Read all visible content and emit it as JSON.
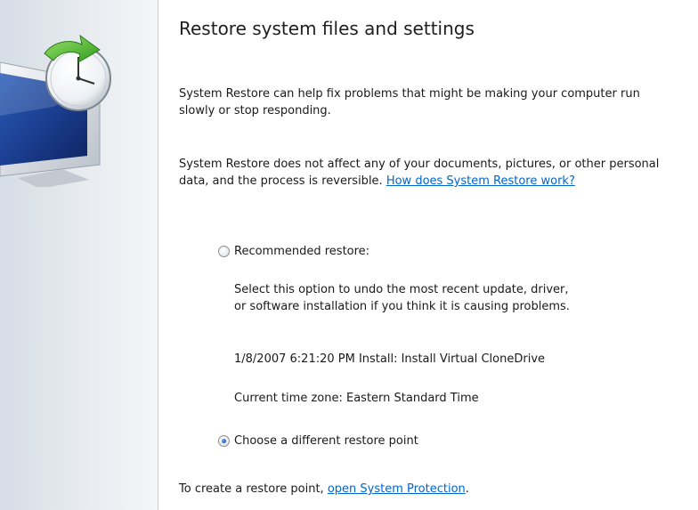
{
  "header": {
    "title": "Restore system files and settings",
    "icon": "system-restore-icon"
  },
  "intro": {
    "paragraph1": "System Restore can help fix problems that might be making your computer run slowly or stop responding.",
    "paragraph2_text": "System Restore does not affect any of your documents, pictures, or other personal data, and the process is reversible. ",
    "paragraph2_link": "How does System Restore work?"
  },
  "options": {
    "recommended": {
      "label": "Recommended restore:",
      "selected": false,
      "description_line1": "Select this option to undo the most recent update, driver,",
      "description_line2": "or software installation if you think it is causing problems.",
      "restore_point": "1/8/2007 6:21:20 PM Install: Install Virtual CloneDrive",
      "time_zone": "Current time zone: Eastern Standard Time"
    },
    "different": {
      "label": "Choose a different restore point",
      "selected": true
    }
  },
  "footer": {
    "text": "To create a restore point, ",
    "link": "open System Protection",
    "suffix": "."
  },
  "colors": {
    "link": "#0066cc",
    "radio_selected": "#1457c4"
  }
}
